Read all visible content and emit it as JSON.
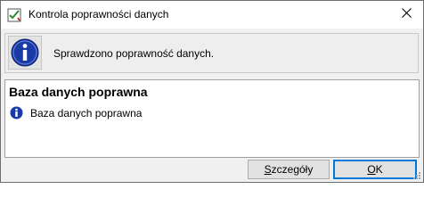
{
  "window": {
    "title": "Kontrola poprawności danych",
    "app_icon": "checklist-icon",
    "close_icon": "close-icon"
  },
  "header": {
    "icon": "info-icon",
    "message": "Sprawdzono poprawność danych."
  },
  "result": {
    "title": "Baza danych poprawna",
    "items": [
      {
        "icon": "info-icon",
        "text": "Baza danych poprawna"
      }
    ]
  },
  "buttons": {
    "details": {
      "mnemonic": "S",
      "rest": "zczegóły"
    },
    "ok": {
      "mnemonic": "O",
      "rest": "K"
    }
  },
  "colors": {
    "info_blue": "#1a3aa8",
    "accent": "#0078d7"
  }
}
